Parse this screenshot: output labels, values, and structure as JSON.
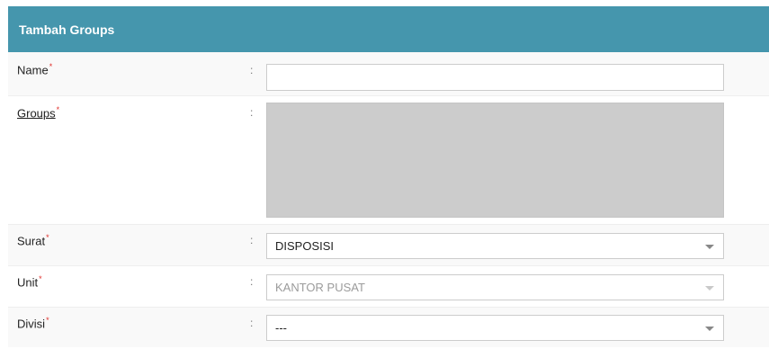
{
  "panel": {
    "title": "Tambah Groups"
  },
  "form": {
    "name": {
      "label": "Name",
      "colon": ":",
      "required": "*",
      "value": ""
    },
    "groups": {
      "label": "Groups",
      "colon": ":",
      "required": "*"
    },
    "surat": {
      "label": "Surat",
      "colon": ":",
      "required": "*",
      "selected": "DISPOSISI"
    },
    "unit": {
      "label": "Unit",
      "colon": ":",
      "required": "*",
      "selected": "KANTOR PUSAT"
    },
    "divisi": {
      "label": "Divisi",
      "colon": ":",
      "required": "*",
      "selected": "---"
    }
  },
  "colors": {
    "header": "#4596ad",
    "required": "#e0302c",
    "multiselect_bg": "#cccccc"
  }
}
